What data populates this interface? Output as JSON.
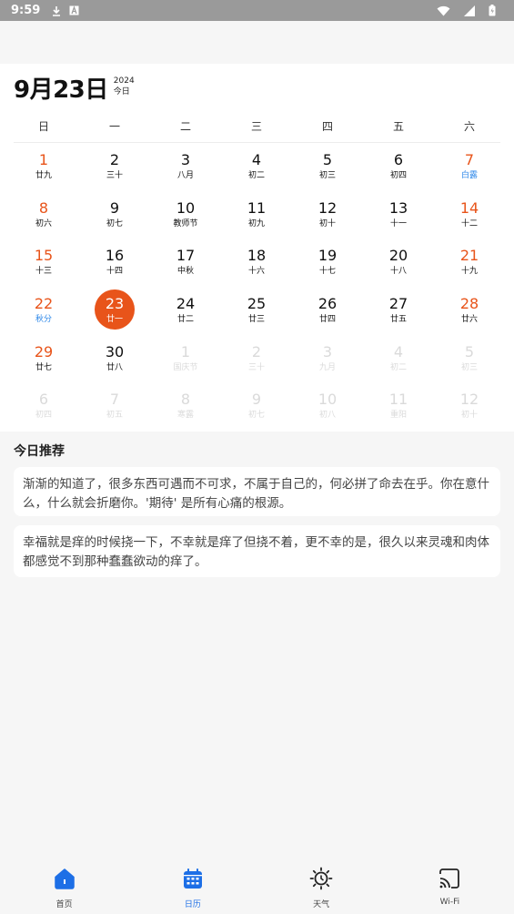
{
  "status_bar": {
    "time": "9:59",
    "icons": [
      "download-icon",
      "a-icon",
      "wifi-icon",
      "signal-icon",
      "battery-icon"
    ]
  },
  "calendar": {
    "title": "9月23日",
    "year": "2024",
    "today_label": "今日",
    "weekdays": [
      "日",
      "一",
      "二",
      "三",
      "四",
      "五",
      "六"
    ],
    "accent_color": "#e8541a",
    "festival_color": "#2a86e8",
    "days": [
      {
        "day": "1",
        "lunar": "廿九",
        "weekend": true
      },
      {
        "day": "2",
        "lunar": "三十"
      },
      {
        "day": "3",
        "lunar": "八月"
      },
      {
        "day": "4",
        "lunar": "初二"
      },
      {
        "day": "5",
        "lunar": "初三"
      },
      {
        "day": "6",
        "lunar": "初四"
      },
      {
        "day": "7",
        "lunar": "白露",
        "weekend": true,
        "festival": true
      },
      {
        "day": "8",
        "lunar": "初六",
        "weekend": true
      },
      {
        "day": "9",
        "lunar": "初七"
      },
      {
        "day": "10",
        "lunar": "教师节"
      },
      {
        "day": "11",
        "lunar": "初九"
      },
      {
        "day": "12",
        "lunar": "初十"
      },
      {
        "day": "13",
        "lunar": "十一"
      },
      {
        "day": "14",
        "lunar": "十二",
        "weekend": true
      },
      {
        "day": "15",
        "lunar": "十三",
        "weekend": true
      },
      {
        "day": "16",
        "lunar": "十四"
      },
      {
        "day": "17",
        "lunar": "中秋"
      },
      {
        "day": "18",
        "lunar": "十六"
      },
      {
        "day": "19",
        "lunar": "十七"
      },
      {
        "day": "20",
        "lunar": "十八"
      },
      {
        "day": "21",
        "lunar": "十九",
        "weekend": true
      },
      {
        "day": "22",
        "lunar": "秋分",
        "weekend": true,
        "festival": true
      },
      {
        "day": "23",
        "lunar": "廿一",
        "today": true
      },
      {
        "day": "24",
        "lunar": "廿二"
      },
      {
        "day": "25",
        "lunar": "廿三"
      },
      {
        "day": "26",
        "lunar": "廿四"
      },
      {
        "day": "27",
        "lunar": "廿五"
      },
      {
        "day": "28",
        "lunar": "廿六",
        "weekend": true
      },
      {
        "day": "29",
        "lunar": "廿七",
        "weekend": true
      },
      {
        "day": "30",
        "lunar": "廿八"
      },
      {
        "day": "1",
        "lunar": "国庆节",
        "dim": true
      },
      {
        "day": "2",
        "lunar": "三十",
        "dim": true
      },
      {
        "day": "3",
        "lunar": "九月",
        "dim": true
      },
      {
        "day": "4",
        "lunar": "初二",
        "dim": true
      },
      {
        "day": "5",
        "lunar": "初三",
        "dim": true
      },
      {
        "day": "6",
        "lunar": "初四",
        "dim": true
      },
      {
        "day": "7",
        "lunar": "初五",
        "dim": true
      },
      {
        "day": "8",
        "lunar": "寒露",
        "dim": true
      },
      {
        "day": "9",
        "lunar": "初七",
        "dim": true
      },
      {
        "day": "10",
        "lunar": "初八",
        "dim": true
      },
      {
        "day": "11",
        "lunar": "重阳",
        "dim": true
      },
      {
        "day": "12",
        "lunar": "初十",
        "dim": true
      }
    ]
  },
  "recommend": {
    "title": "今日推荐",
    "quotes": [
      "渐渐的知道了，很多东西可遇而不可求，不属于自己的，何必拼了命去在乎。你在意什么，什么就会折磨你。'期待' 是所有心痛的根源。",
      "幸福就是痒的时候挠一下，不幸就是痒了但挠不着，更不幸的是，很久以来灵魂和肉体都感觉不到那种蠢蠢欲动的痒了。"
    ]
  },
  "bottom_nav": {
    "active_color": "#1d6fe6",
    "items": [
      {
        "label": "首页",
        "icon": "home-icon"
      },
      {
        "label": "日历",
        "icon": "calendar-icon",
        "active": true
      },
      {
        "label": "天气",
        "icon": "weather-icon"
      },
      {
        "label": "Wi-Fi",
        "icon": "cast-icon"
      }
    ]
  }
}
